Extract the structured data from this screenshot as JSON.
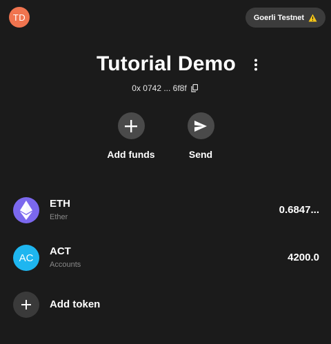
{
  "account": {
    "avatar_initials": "TD",
    "avatar_color": "#f0744f"
  },
  "network": {
    "label": "Goerli Testnet",
    "icon": "warning-icon"
  },
  "wallet": {
    "title": "Tutorial Demo",
    "address_short": "0x 0742 ... 6f8f"
  },
  "actions": [
    {
      "label": "Add funds",
      "icon": "plus-icon"
    },
    {
      "label": "Send",
      "icon": "send-icon"
    }
  ],
  "tokens": [
    {
      "symbol": "ETH",
      "name": "Ether",
      "balance": "0.6847...",
      "icon": "ethereum-icon",
      "color": "#7b68ee"
    },
    {
      "symbol": "ACT",
      "name": "Accounts",
      "balance": "4200.0",
      "icon_text": "AC",
      "color": "#1eb6f0"
    }
  ],
  "add_token": {
    "label": "Add token",
    "icon": "plus-icon"
  },
  "colors": {
    "background": "#1b1b1b",
    "chip": "#3c3c3c",
    "action_circle": "#4a4a4a",
    "warning": "#f5c518"
  }
}
